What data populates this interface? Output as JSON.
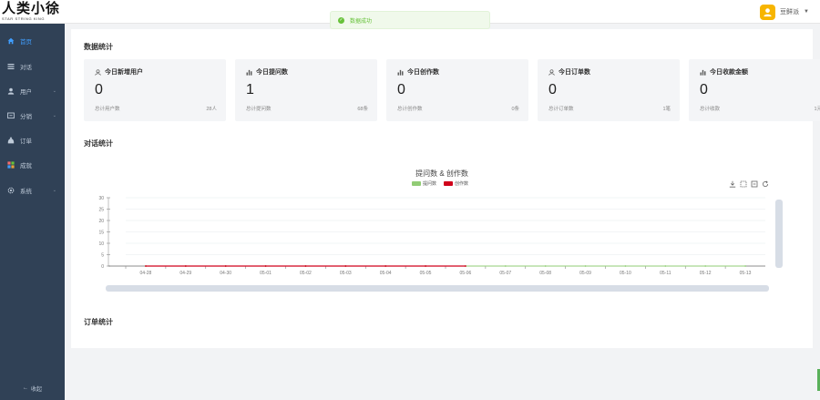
{
  "app": {
    "logo_text": "人类小徐",
    "logo_sub": "STAR STRING KING",
    "username": "豆鲜派",
    "toast_message": "数据成功"
  },
  "sidebar": {
    "items": [
      {
        "label": "首页",
        "icon": "home-icon",
        "active": true,
        "has_arrow": false
      },
      {
        "label": "对话",
        "icon": "menu-lines-icon",
        "active": false,
        "has_arrow": false
      },
      {
        "label": "用户",
        "icon": "user-icon",
        "active": false,
        "has_arrow": true
      },
      {
        "label": "分销",
        "icon": "share-icon",
        "active": false,
        "has_arrow": true
      },
      {
        "label": "订单",
        "icon": "money-bag-icon",
        "active": false,
        "has_arrow": false
      },
      {
        "label": "成就",
        "icon": "grid-color-icon",
        "active": false,
        "has_arrow": false
      },
      {
        "label": "系统",
        "icon": "settings-icon",
        "active": false,
        "has_arrow": true
      }
    ],
    "collapse_label": "收起"
  },
  "stats": {
    "section_title": "数据统计",
    "cards": [
      {
        "icon": "user-outline-icon",
        "title": "今日新增用户",
        "value": "0",
        "sub_label": "总计用户数",
        "sub_value": "28人"
      },
      {
        "icon": "bar-chart-icon",
        "title": "今日提问数",
        "value": "1",
        "sub_label": "总计提问数",
        "sub_value": "68条"
      },
      {
        "icon": "bar-chart-icon",
        "title": "今日创作数",
        "value": "0",
        "sub_label": "总计创作数",
        "sub_value": "0条"
      },
      {
        "icon": "user-outline-icon",
        "title": "今日订单数",
        "value": "0",
        "sub_label": "总计订单数",
        "sub_value": "1笔"
      },
      {
        "icon": "bar-chart-icon",
        "title": "今日收款金额",
        "value": "0",
        "sub_label": "总计收款",
        "sub_value": "1元"
      }
    ]
  },
  "dialog_section": {
    "title": "对话统计"
  },
  "order_section": {
    "title": "订单统计"
  },
  "chart_data": {
    "type": "line",
    "title": "提问数 & 创作数",
    "categories": [
      "04-28",
      "04-29",
      "04-30",
      "05-01",
      "05-02",
      "05-03",
      "05-04",
      "05-05",
      "05-06",
      "05-07",
      "05-08",
      "05-09",
      "05-10",
      "05-11",
      "05-12",
      "05-13"
    ],
    "series": [
      {
        "name": "提问数",
        "color": "#91cc75",
        "values": [
          0,
          0,
          0,
          0,
          0,
          0,
          0,
          0,
          0,
          0,
          0,
          0,
          0,
          0,
          0,
          0
        ]
      },
      {
        "name": "创作数",
        "color": "#d0021b",
        "values": [
          0,
          0,
          0,
          0,
          0,
          0,
          0,
          0,
          0,
          null,
          null,
          null,
          null,
          null,
          null,
          null
        ]
      }
    ],
    "ylim": [
      0,
      30
    ],
    "yticks": [
      0,
      5,
      10,
      15,
      20,
      25,
      30
    ],
    "grid": true,
    "legend": "top-center"
  }
}
